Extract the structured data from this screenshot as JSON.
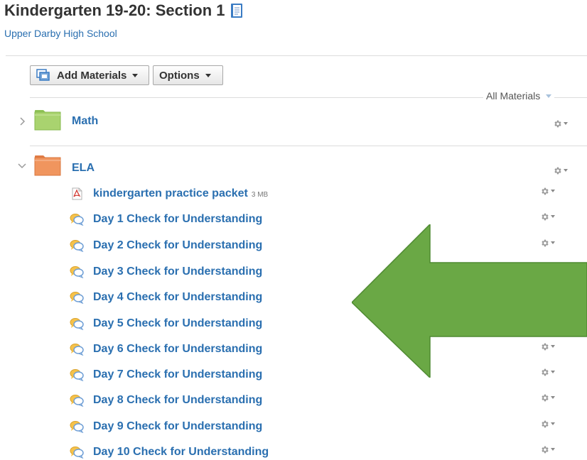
{
  "header": {
    "title": "Kindergarten 19-20: Section 1",
    "school": "Upper Darby High School"
  },
  "toolbar": {
    "add_materials_label": "Add Materials",
    "options_label": "Options",
    "filter_label": "All Materials"
  },
  "folders": [
    {
      "name": "Math",
      "color": "#a9d36f",
      "expanded": false
    },
    {
      "name": "ELA",
      "color": "#f0955e",
      "expanded": true
    }
  ],
  "ela_items": [
    {
      "label": "kindergarten practice packet",
      "size": "3 MB",
      "icon": "pdf-icon"
    },
    {
      "label": "Day 1 Check for Understanding",
      "icon": "discussion-icon"
    },
    {
      "label": "Day 2 Check for Understanding",
      "icon": "discussion-icon"
    },
    {
      "label": "Day 3 Check for Understanding",
      "icon": "discussion-icon"
    },
    {
      "label": "Day 4 Check for Understanding",
      "icon": "discussion-icon"
    },
    {
      "label": "Day 5 Check for Understanding",
      "icon": "discussion-icon"
    },
    {
      "label": "Day 6 Check for Understanding",
      "icon": "discussion-icon"
    },
    {
      "label": "Day 7 Check for Understanding",
      "icon": "discussion-icon"
    },
    {
      "label": "Day 8 Check for Understanding",
      "icon": "discussion-icon"
    },
    {
      "label": "Day 9 Check for Understanding",
      "icon": "discussion-icon"
    },
    {
      "label": "Day 10 Check for Understanding",
      "icon": "discussion-icon"
    }
  ],
  "colors": {
    "link": "#2a6fb0",
    "annotation_arrow": "#6aa845"
  }
}
